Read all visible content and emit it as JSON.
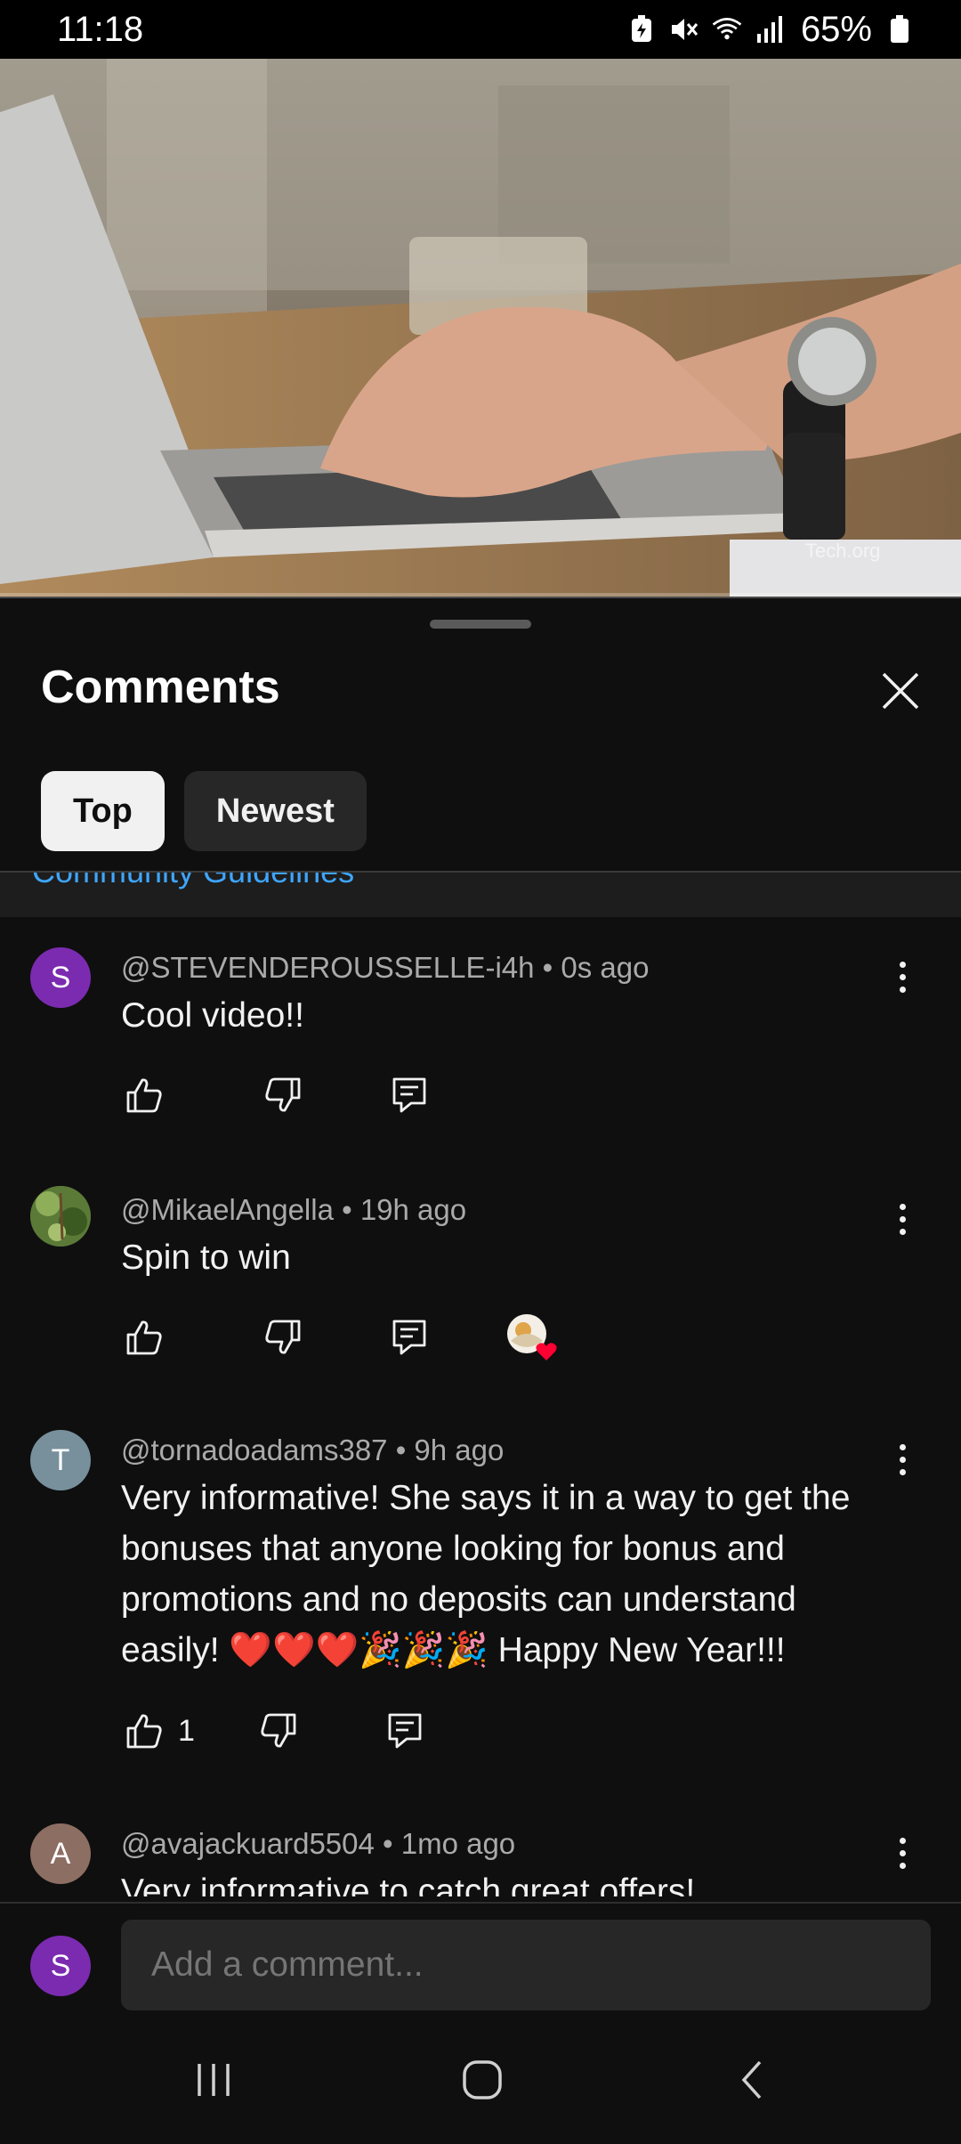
{
  "status_bar": {
    "time": "11:18",
    "battery": "65%",
    "icons": [
      "battery-saver-icon",
      "mute-icon",
      "wifi-icon",
      "signal-icon",
      "battery-icon"
    ]
  },
  "video": {
    "watermark": "Tech.org",
    "description_icon": "video-thumbnail"
  },
  "sheet": {
    "title": "Comments",
    "close_icon": "close-icon",
    "filters": [
      {
        "label": "Top",
        "selected": true
      },
      {
        "label": "Newest",
        "selected": false
      }
    ],
    "guidelines_link": "Community Guidelines"
  },
  "comments": [
    {
      "avatar_letter": "S",
      "avatar_color": "#7b2bb0",
      "meta": "@STEVENDEROUSSELLE-i4h • 0s ago",
      "text": "Cool video!!",
      "likes": "",
      "creator_heart": false
    },
    {
      "avatar_letter": "",
      "avatar_color": "#4a6b2e",
      "meta": "@MikaelAngella • 19h ago",
      "text": "Spin to win",
      "likes": "",
      "creator_heart": true
    },
    {
      "avatar_letter": "T",
      "avatar_color": "#78909c",
      "meta": "@tornadoadams387 • 9h ago",
      "text": "Very informative! She says it in a way to get the bonuses that anyone looking for bonus and promotions and no deposits can understand easily! ❤️❤️❤️🎉🎉🎉 Happy New Year!!!",
      "likes": "1",
      "creator_heart": false
    },
    {
      "avatar_letter": "A",
      "avatar_color": "#8d6e63",
      "meta": "@avajackuard5504 • 1mo ago",
      "text": "Very informative to catch great offers!",
      "likes": "",
      "creator_heart": false
    }
  ],
  "composer": {
    "avatar_letter": "S",
    "avatar_color": "#7b2bb0",
    "placeholder": "Add a comment..."
  },
  "nav_bar": {
    "buttons": [
      "recents-icon",
      "home-icon",
      "back-icon"
    ]
  }
}
